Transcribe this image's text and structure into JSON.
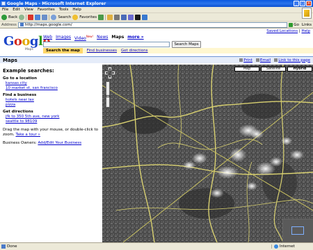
{
  "window": {
    "title": "Google Maps - Microsoft Internet Explorer"
  },
  "menu": [
    "File",
    "Edit",
    "View",
    "Favorites",
    "Tools",
    "Help"
  ],
  "toolbar": {
    "back_label": "Back",
    "search_label": "Search",
    "favorites_label": "Favorites"
  },
  "address": {
    "label": "Address",
    "url": "http://maps.google.com/",
    "go_label": "Go",
    "links_label": "Links"
  },
  "top_links": {
    "saved": "Saved Locations",
    "sep": " | ",
    "help": "Help"
  },
  "logo": {
    "g1": "G",
    "o1": "o",
    "o2": "o",
    "g2": "g",
    "l": "l",
    "e": "e",
    "sub": "Maps"
  },
  "nav_tabs": [
    {
      "label": "Web"
    },
    {
      "label": "Images"
    },
    {
      "label": "Video",
      "sup": "New!"
    },
    {
      "label": "News"
    },
    {
      "label": "Maps"
    },
    {
      "label": "more »"
    }
  ],
  "search": {
    "button": "Search Maps"
  },
  "actions": {
    "search_map": "Search the map",
    "find_businesses": "Find businesses",
    "get_directions": "Get directions"
  },
  "mapsbar": {
    "heading": "Maps",
    "print": "Print",
    "email": "Email",
    "link": "Link to this page"
  },
  "sidebar": {
    "heading": "Example searches:",
    "go_title": "Go to a location",
    "go_items": [
      "kansas city",
      "10 market st, san francisco"
    ],
    "find_title": "Find a business",
    "find_items": [
      "hotels near lax",
      "pizza"
    ],
    "dir_title": "Get directions",
    "dir_items": [
      "jfk to 350 5th ave, new york",
      "seattle to 98109"
    ],
    "drag_text": "Drag the map with your mouse, or double-click to zoom.",
    "tour": "Take a tour »",
    "owners_text": "Business Owners:",
    "owners_link": "Add/Edit Your Business"
  },
  "map_types": {
    "map": "Map",
    "satellite": "Satellite",
    "hybrid": "Hybrid",
    "active": "hybrid"
  },
  "map": {
    "zoom_level_fraction": 0.6
  },
  "status": {
    "left": "Done",
    "zone": "Internet"
  }
}
